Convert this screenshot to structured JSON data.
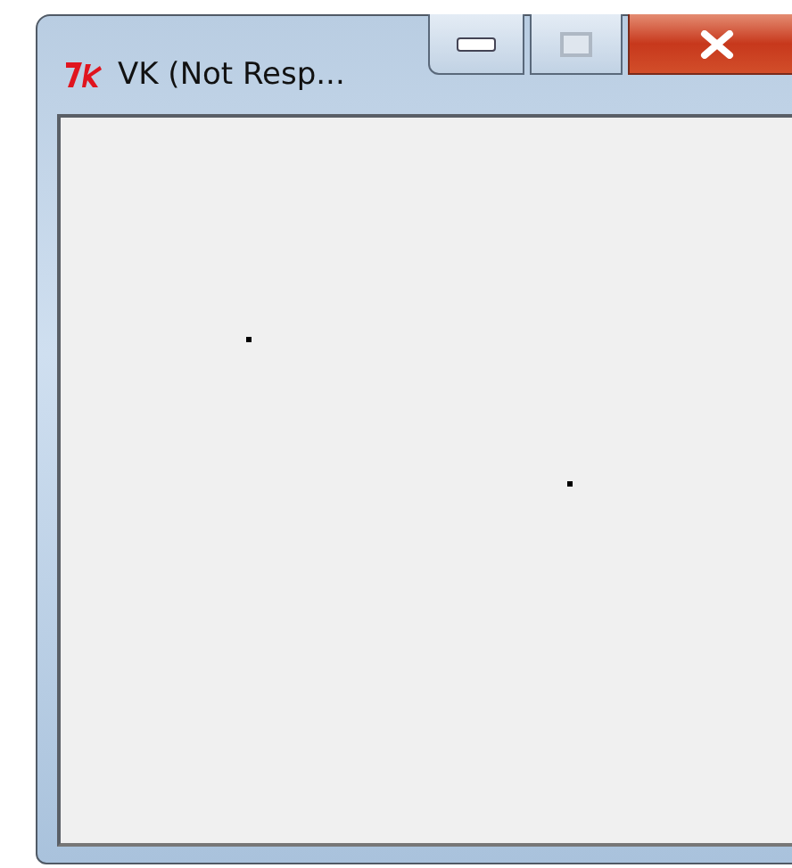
{
  "window": {
    "title": "VK (Not Resp..."
  }
}
